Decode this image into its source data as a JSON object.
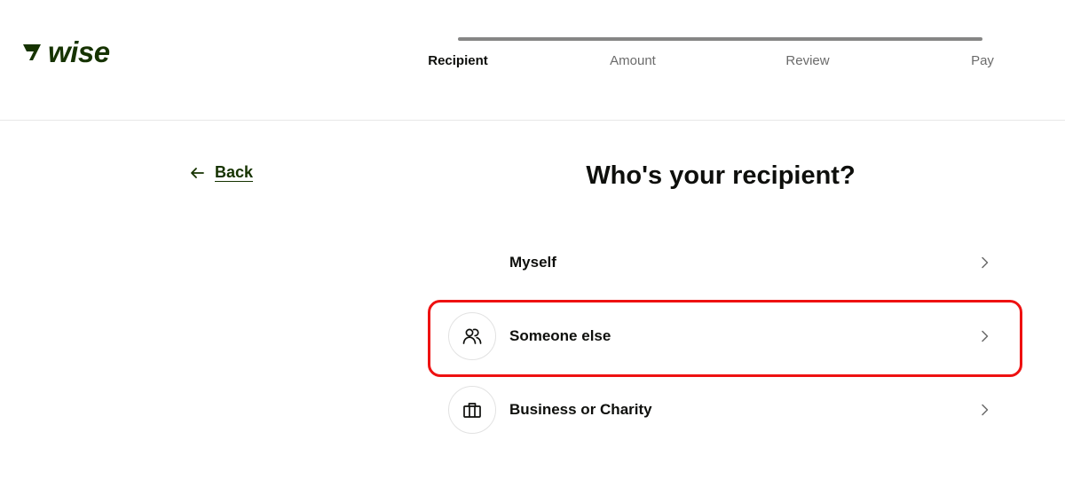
{
  "brand": {
    "name": "wise",
    "color": "#163300"
  },
  "stepper": {
    "steps": [
      {
        "label": "Recipient",
        "active": true
      },
      {
        "label": "Amount",
        "active": false
      },
      {
        "label": "Review",
        "active": false
      },
      {
        "label": "Pay",
        "active": false
      }
    ]
  },
  "nav": {
    "back_label": "Back"
  },
  "main": {
    "title": "Who's your recipient?",
    "options": [
      {
        "label": "Myself",
        "icon": "none"
      },
      {
        "label": "Someone else",
        "icon": "people-icon"
      },
      {
        "label": "Business or Charity",
        "icon": "briefcase-icon"
      }
    ]
  },
  "colors": {
    "highlight": "#ee1111",
    "progress": "#868685"
  }
}
